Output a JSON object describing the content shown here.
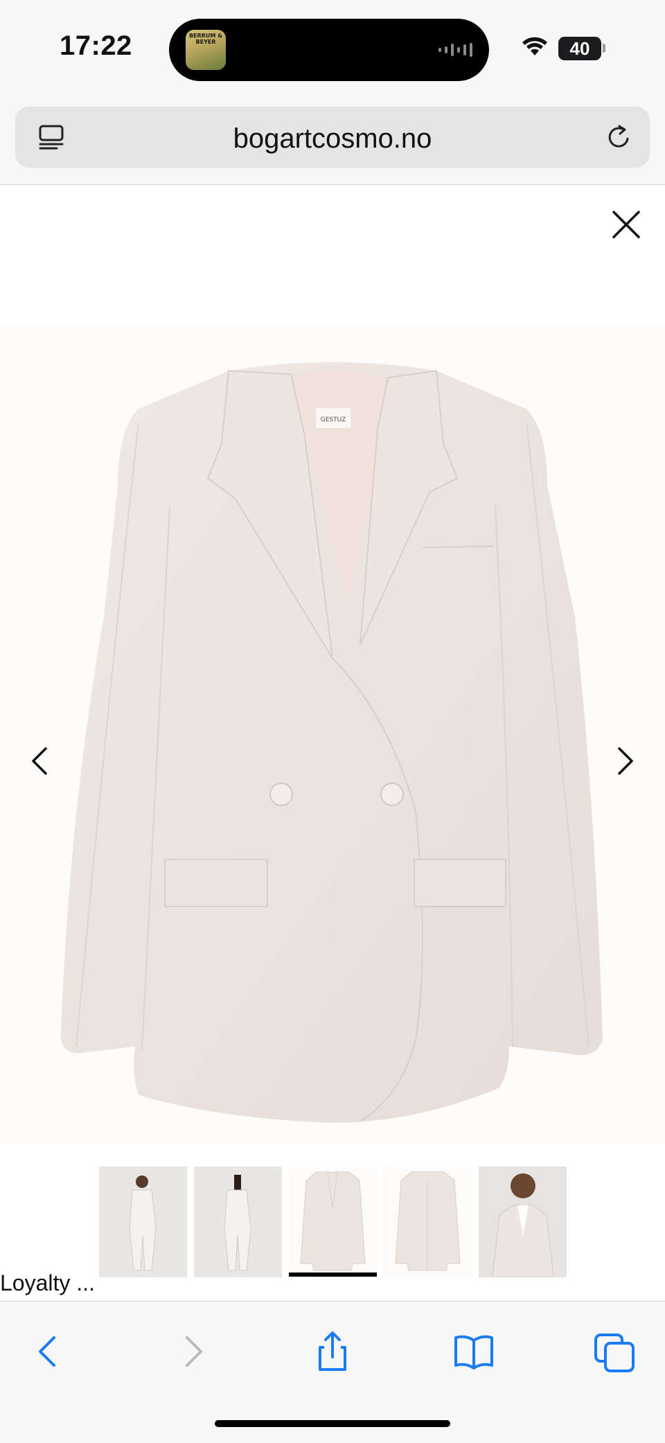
{
  "status_bar": {
    "time": "17:22",
    "battery": "40",
    "live_activity": {
      "album_art_text": "BERRUM & BEYER",
      "icon": "audio-waveform-icon"
    },
    "icons": [
      "wifi-icon",
      "battery-icon"
    ]
  },
  "browser": {
    "url": "bogartcosmo.no",
    "tabs_icon": "tabs-overview-icon",
    "reload_icon": "reload-icon"
  },
  "gallery": {
    "close_icon": "close-icon",
    "prev_icon": "chevron-left-icon",
    "next_icon": "chevron-right-icon",
    "image_brand_label": "GESTUZ",
    "selected_thumbnail_index": 2,
    "thumbnail_count": 5,
    "thumbnails": [
      {
        "name": "model-front"
      },
      {
        "name": "model-back"
      },
      {
        "name": "blazer-front"
      },
      {
        "name": "blazer-back"
      },
      {
        "name": "model-closeup"
      }
    ]
  },
  "loyalty_label": "Loyalty ...",
  "toolbar": {
    "buttons": [
      "back-icon",
      "forward-icon",
      "share-icon",
      "bookmarks-icon",
      "tabs-icon"
    ]
  },
  "colors": {
    "accent": "#1a7cf4",
    "disabled": "#b9b9be",
    "blazer": "#ece4df"
  }
}
